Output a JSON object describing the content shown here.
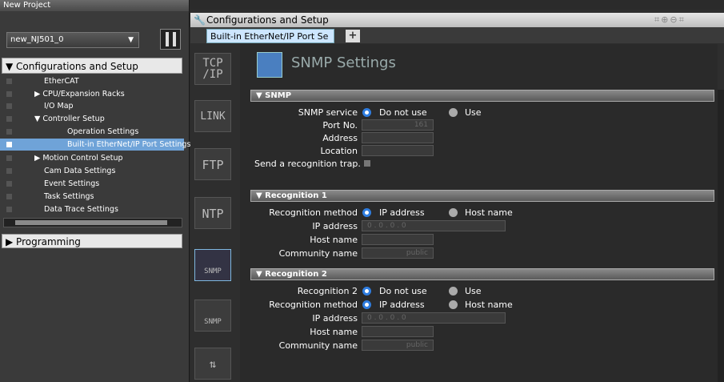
{
  "left_pane": {
    "title": "New Project",
    "project_combo": "new_NJ501_0",
    "tree_header": "▼ Configurations and Setup",
    "tree": [
      {
        "label": "EtherCAT",
        "indent": 0
      },
      {
        "label": "▶ CPU/Expansion Racks",
        "indent": 0
      },
      {
        "label": "I/O Map",
        "indent": 0
      },
      {
        "label": "▼ Controller Setup",
        "indent": 0
      },
      {
        "label": "Operation Settings",
        "indent": 1
      },
      {
        "label": "Built-in EtherNet/IP Port Settings",
        "indent": 1
      },
      {
        "label": "▶ Motion Control Setup",
        "indent": 0
      },
      {
        "label": "Cam Data Settings",
        "indent": 0
      },
      {
        "label": "Event Settings",
        "indent": 0
      },
      {
        "label": "Task Settings",
        "indent": 0
      },
      {
        "label": "Data Trace Settings",
        "indent": 0
      }
    ],
    "programming_header": "▶ Programming"
  },
  "right_pane": {
    "title": "Configurations and Setup",
    "tab_label": "Built-in EtherNet/IP Port Se",
    "tab_add": "+"
  },
  "nav": {
    "tcpip": "TCP\n/IP",
    "link": "LINK",
    "ftp": "FTP",
    "ntp": "NTP",
    "snmp": "SNMP",
    "snmp_trap": "SNMP"
  },
  "page": {
    "title": "SNMP Settings",
    "snmp_section": "▼ SNMP",
    "snmp_service_label": "SNMP service",
    "do_not_use": "Do not use",
    "use": "Use",
    "port_label": "Port No.",
    "port_value": "161",
    "address_label": "Address",
    "location_label": "Location",
    "trap_label": "Send a recognition trap.",
    "rec1_section": "▼ Recognition 1",
    "rec_method_label": "Recognition method",
    "ip_address_opt": "IP address",
    "host_name_opt": "Host name",
    "ip_address_label": "IP address",
    "ip_placeholder": "0 . 0 . 0 . 0",
    "host_name_label": "Host name",
    "community_label": "Community name",
    "community_value": "public",
    "rec2_section": "▼ Recognition 2",
    "rec2_label": "Recognition 2"
  }
}
